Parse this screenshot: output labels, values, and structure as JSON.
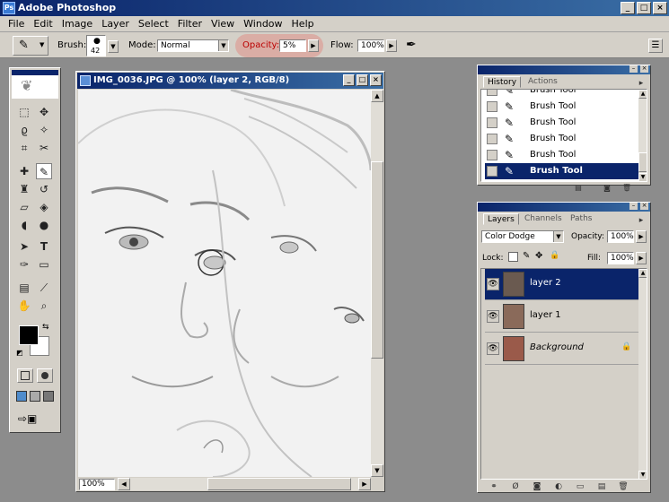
{
  "app": {
    "title": "Adobe Photoshop"
  },
  "window_buttons": [
    "_",
    "□",
    "×"
  ],
  "menu": [
    "File",
    "Edit",
    "Image",
    "Layer",
    "Select",
    "Filter",
    "View",
    "Window",
    "Help"
  ],
  "options": {
    "brush_label": "Brush:",
    "brush_size": "42",
    "mode_label": "Mode:",
    "mode_value": "Normal",
    "opacity_label": "Opacity:",
    "opacity_value": "5%",
    "flow_label": "Flow:",
    "flow_value": "100%",
    "highlight_color": "#e8524a"
  },
  "document": {
    "title": "IMG_0036.JPG @ 100% (layer 2, RGB/8)",
    "zoom": "100%"
  },
  "history": {
    "tabs": [
      "History",
      "Actions"
    ],
    "items": [
      "Brush Tool",
      "Brush Tool",
      "Brush Tool",
      "Brush Tool",
      "Brush Tool",
      "Brush Tool"
    ],
    "selected_index": 5
  },
  "layers": {
    "tabs": [
      "Layers",
      "Channels",
      "Paths"
    ],
    "blend_mode": "Color Dodge",
    "opacity_label": "Opacity:",
    "opacity_value": "100%",
    "lock_label": "Lock:",
    "fill_label": "Fill:",
    "fill_value": "100%",
    "items": [
      "layer 2",
      "layer 1",
      "Background"
    ],
    "selected_index": 0
  },
  "colors": {
    "titlebar": "#0a246a",
    "selection": "#0a246a",
    "chrome": "#d4d0c8",
    "workspace": "#8c8c8c"
  }
}
